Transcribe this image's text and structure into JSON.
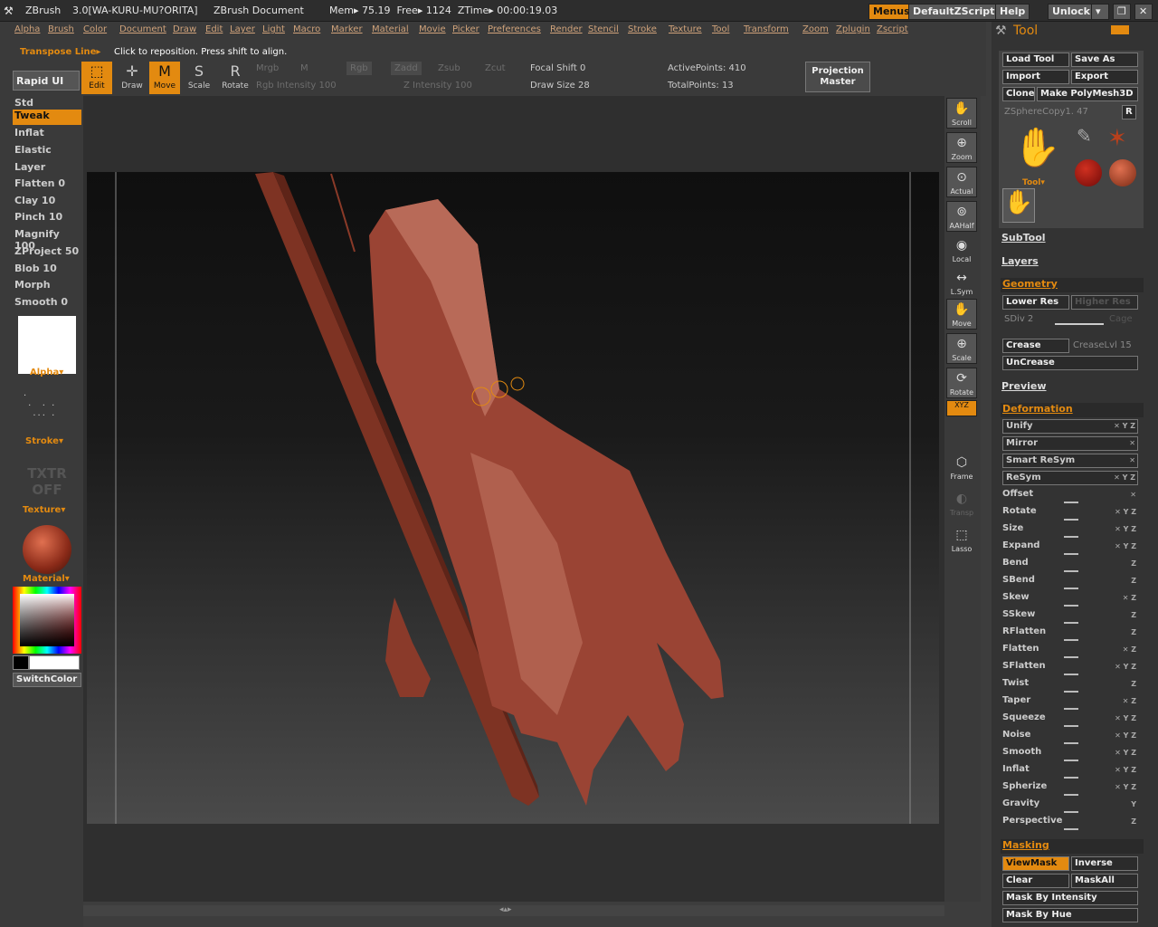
{
  "titlebar": {
    "app": "ZBrush",
    "version": "3.0[WA-KURU-MU?ORITA]",
    "document": "ZBrush Document",
    "mem": "Mem▸ 75.19  Free▸ 1124  ZTime▸ 00:00:19.03",
    "buttons": [
      "Menus",
      "DefaultZScript",
      "Help",
      "Unlock"
    ]
  },
  "menu": [
    "Alpha",
    "Brush",
    "Color",
    "Document",
    "Draw",
    "Edit",
    "Layer",
    "Light",
    "Macro",
    "Marker",
    "Material",
    "Movie",
    "Picker",
    "Preferences",
    "Render",
    "Stencil",
    "Stroke",
    "Texture",
    "Tool",
    "Transform",
    "Zoom",
    "Zplugin",
    "Zscript"
  ],
  "hint": {
    "title": "Transpose Line▸",
    "text": "Click to reposition. Press shift to align."
  },
  "toolbar": {
    "rapid": "Rapid UI",
    "edit": "Edit",
    "draw": "Draw",
    "move": "Move",
    "scale": "Scale",
    "rotate": "Rotate",
    "mrgb": "Mrgb",
    "m": "M",
    "rgb": "Rgb",
    "zadd": "Zadd",
    "zsub": "Zsub",
    "zcut": "Zcut",
    "rgb_int": "Rgb  Intensity 100",
    "z_int": "Z  Intensity 100",
    "focal": "Focal  Shift 0",
    "drawsize": "Draw  Size 28",
    "active": "ActivePoints: 410",
    "total": "TotalPoints: 13",
    "proj": "Projection Master"
  },
  "brushes": [
    "Std",
    "Tweak",
    "Inflat",
    "Elastic",
    "Layer",
    "Flatten 0",
    "Clay 10",
    "Pinch 10",
    "Magnify 100",
    "ZProject 50",
    "Blob 10",
    "Morph",
    "Smooth 0"
  ],
  "left": {
    "alpha": "Alpha▾",
    "stroke": "Stroke▾",
    "txtr": "TXTR OFF",
    "texture": "Texture▾",
    "material": "Material▾",
    "switch": "SwitchColor"
  },
  "rightstrip": [
    "Scroll",
    "Zoom",
    "Actual",
    "AAHalf",
    "Local",
    "L.Sym",
    "Move",
    "Scale",
    "Rotate",
    "XYZ",
    "Frame",
    "Transp",
    "Lasso"
  ],
  "tool": {
    "title": "Tool",
    "buttons": [
      "Load Tool",
      "Save As",
      "Import",
      "Export",
      "Clone",
      "Make PolyMesh3D"
    ],
    "current": "ZSphereCopy1. 47",
    "r": "R",
    "toolLabel": "Tool▾",
    "subtool": "SubTool",
    "layers": "Layers",
    "geometry": "Geometry",
    "lower": "Lower Res",
    "higher": "Higher Res",
    "sdiv": "SDiv 2",
    "cage": "Cage",
    "crease": "Crease",
    "creaselvl": "CreaseLvl 15",
    "uncrease": "UnCrease",
    "preview": "Preview",
    "deformation": "Deformation",
    "deform": [
      "Unify",
      "Mirror",
      "Smart ReSym",
      "ReSym",
      "Offset",
      "Rotate",
      "Size",
      "Expand",
      "Bend",
      "SBend",
      "Skew",
      "SSkew",
      "RFlatten",
      "Flatten",
      "SFlatten",
      "Twist",
      "Taper",
      "Squeeze",
      "Noise",
      "Smooth",
      "Inflat",
      "Spherize",
      "Gravity",
      "Perspective"
    ],
    "masking": "Masking",
    "mask": [
      "ViewMask",
      "Inverse",
      "Clear",
      "MaskAll",
      "Mask By Intensity",
      "Mask By Hue"
    ]
  }
}
